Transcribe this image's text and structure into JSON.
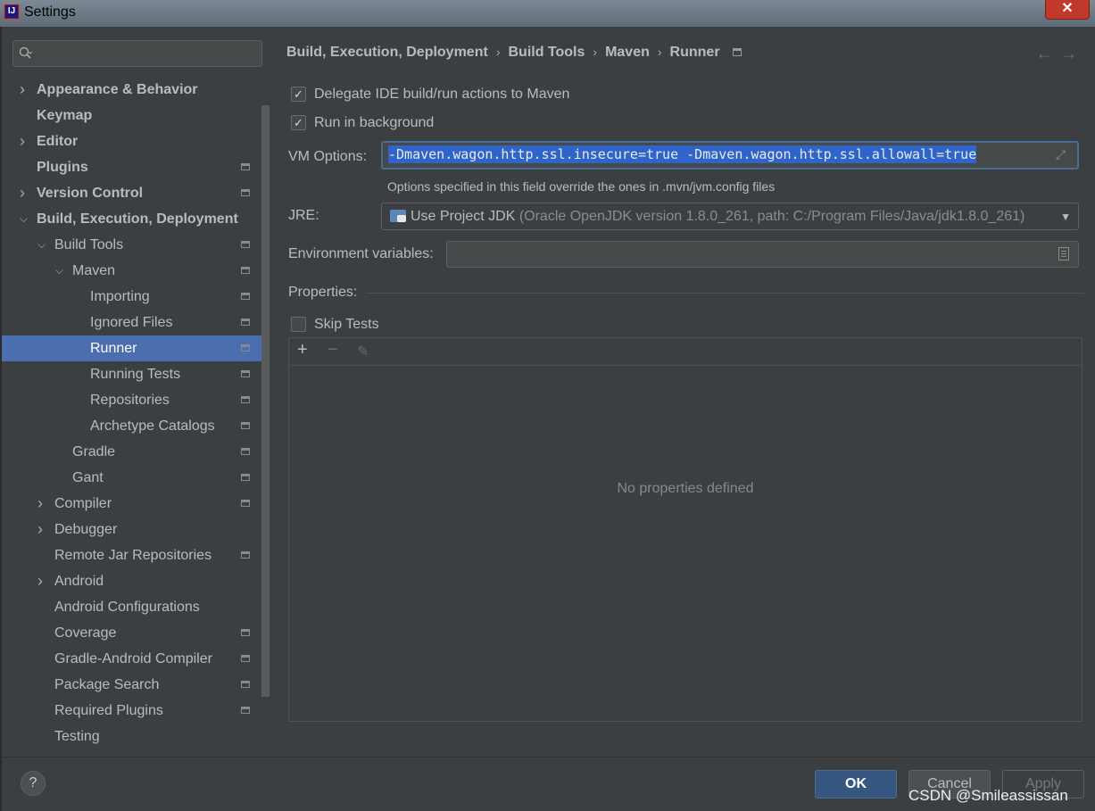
{
  "window": {
    "title": "Settings",
    "app_icon_letter": "IJ"
  },
  "search": {
    "placeholder": ""
  },
  "tree": [
    {
      "label": "Appearance & Behavior",
      "bold": true,
      "arrow": "right",
      "indent": 0,
      "badge": false
    },
    {
      "label": "Keymap",
      "bold": true,
      "arrow": "",
      "indent": 0,
      "badge": false
    },
    {
      "label": "Editor",
      "bold": true,
      "arrow": "right",
      "indent": 0,
      "badge": false
    },
    {
      "label": "Plugins",
      "bold": true,
      "arrow": "",
      "indent": 0,
      "badge": true
    },
    {
      "label": "Version Control",
      "bold": true,
      "arrow": "right",
      "indent": 0,
      "badge": true
    },
    {
      "label": "Build, Execution, Deployment",
      "bold": true,
      "arrow": "down",
      "indent": 0,
      "badge": false
    },
    {
      "label": "Build Tools",
      "bold": false,
      "arrow": "down",
      "indent": 1,
      "badge": true
    },
    {
      "label": "Maven",
      "bold": false,
      "arrow": "down",
      "indent": 2,
      "badge": true
    },
    {
      "label": "Importing",
      "bold": false,
      "arrow": "",
      "indent": 3,
      "badge": true
    },
    {
      "label": "Ignored Files",
      "bold": false,
      "arrow": "",
      "indent": 3,
      "badge": true
    },
    {
      "label": "Runner",
      "bold": false,
      "arrow": "",
      "indent": 3,
      "badge": true,
      "selected": true
    },
    {
      "label": "Running Tests",
      "bold": false,
      "arrow": "",
      "indent": 3,
      "badge": true
    },
    {
      "label": "Repositories",
      "bold": false,
      "arrow": "",
      "indent": 3,
      "badge": true
    },
    {
      "label": "Archetype Catalogs",
      "bold": false,
      "arrow": "",
      "indent": 3,
      "badge": true
    },
    {
      "label": "Gradle",
      "bold": false,
      "arrow": "",
      "indent": 2,
      "badge": true
    },
    {
      "label": "Gant",
      "bold": false,
      "arrow": "",
      "indent": 2,
      "badge": true
    },
    {
      "label": "Compiler",
      "bold": false,
      "arrow": "right",
      "indent": 1,
      "badge": true
    },
    {
      "label": "Debugger",
      "bold": false,
      "arrow": "right",
      "indent": 1,
      "badge": false
    },
    {
      "label": "Remote Jar Repositories",
      "bold": false,
      "arrow": "",
      "indent": 1,
      "badge": true
    },
    {
      "label": "Android",
      "bold": false,
      "arrow": "right",
      "indent": 1,
      "badge": false
    },
    {
      "label": "Android Configurations",
      "bold": false,
      "arrow": "",
      "indent": 1,
      "badge": false
    },
    {
      "label": "Coverage",
      "bold": false,
      "arrow": "",
      "indent": 1,
      "badge": true
    },
    {
      "label": "Gradle-Android Compiler",
      "bold": false,
      "arrow": "",
      "indent": 1,
      "badge": true
    },
    {
      "label": "Package Search",
      "bold": false,
      "arrow": "",
      "indent": 1,
      "badge": true
    },
    {
      "label": "Required Plugins",
      "bold": false,
      "arrow": "",
      "indent": 1,
      "badge": true
    },
    {
      "label": "Testing",
      "bold": false,
      "arrow": "",
      "indent": 1,
      "badge": false
    }
  ],
  "breadcrumb": {
    "items": [
      "Build, Execution, Deployment",
      "Build Tools",
      "Maven",
      "Runner"
    ]
  },
  "options": {
    "delegate_label": "Delegate IDE build/run actions to Maven",
    "delegate_checked": true,
    "background_label": "Run in background",
    "background_checked": true
  },
  "vm": {
    "label": "VM Options:",
    "value": "-Dmaven.wagon.http.ssl.insecure=true -Dmaven.wagon.http.ssl.allowall=true",
    "hint": "Options specified in this field override the ones in .mvn/jvm.config files"
  },
  "jre": {
    "label": "JRE:",
    "primary": "Use Project JDK",
    "secondary": "(Oracle OpenJDK version 1.8.0_261, path: C:/Program Files/Java/jdk1.8.0_261)"
  },
  "env": {
    "label": "Environment variables:",
    "value": ""
  },
  "properties": {
    "label": "Properties:",
    "skip_tests_label": "Skip Tests",
    "skip_tests_checked": false,
    "empty_text": "No properties defined"
  },
  "footer": {
    "help": "?",
    "ok": "OK",
    "cancel": "Cancel",
    "apply": "Apply",
    "watermark": "CSDN @Smileassissan"
  }
}
